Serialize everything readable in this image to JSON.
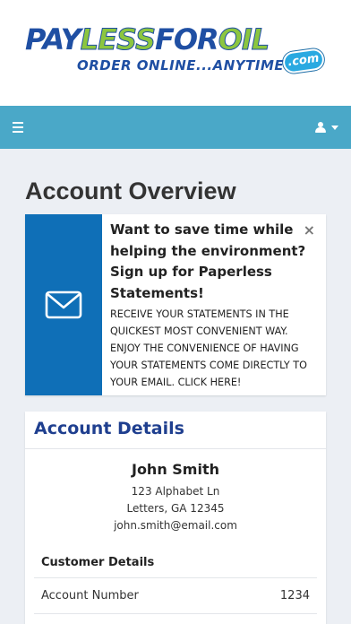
{
  "brand": {
    "logo_pay": "PAY",
    "logo_less": "LESS",
    "logo_for": "FOR",
    "logo_oil": "OIL",
    "logo_com": ".com",
    "tagline": "ORDER ONLINE...ANYTIME",
    "colors": {
      "blue": "#1f4fa3",
      "green": "#8cc63f",
      "sky": "#29a9e1"
    }
  },
  "navbar": {
    "menu_icon": "hamburger-icon",
    "user_icon": "user-icon",
    "color": "#4aa8c8"
  },
  "page": {
    "title": "Account Overview"
  },
  "promo": {
    "icon": "envelope-icon",
    "heading": "Want to save time while helping the environment? Sign up for Paperless Statements!",
    "text": "RECEIVE YOUR STATEMENTS IN THE QUICKEST MOST CONVENIENT WAY. ENJOY THE CONVENIENCE OF HAVING YOUR STATEMENTS COME DIRECTLY TO YOUR EMAIL. CLICK HERE!",
    "close": "×",
    "accent": "#0f6fb7"
  },
  "account_details": {
    "title": "Account Details",
    "customer": {
      "name": "John Smith",
      "address_line1": "123 Alphabet Ln",
      "address_line2": "Letters, GA 12345",
      "email": "john.smith@email.com"
    },
    "section_label": "Customer Details",
    "rows": [
      {
        "label": "Account Number",
        "value": "1234"
      }
    ]
  }
}
